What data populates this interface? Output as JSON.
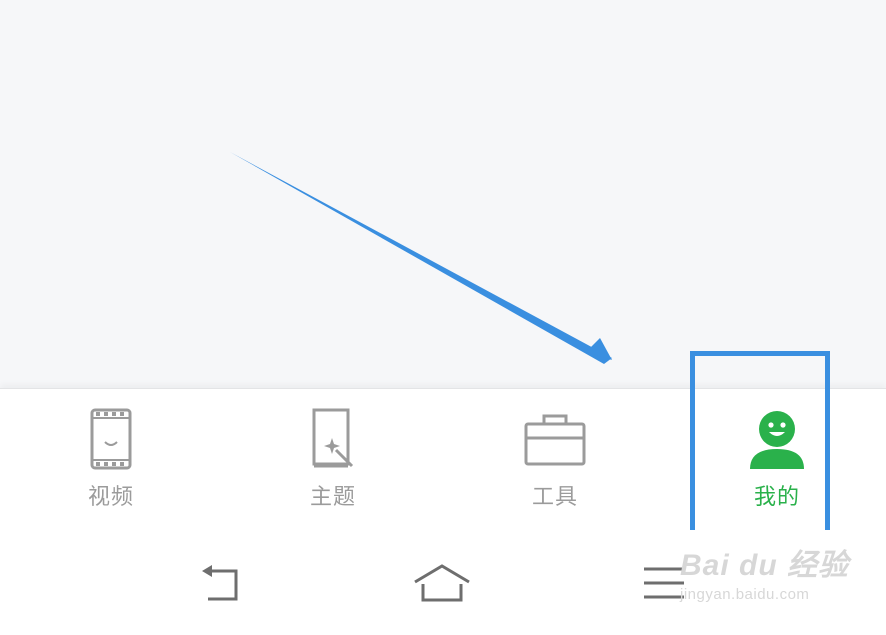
{
  "tabs": [
    {
      "label": "视频",
      "icon": "video-phone-icon",
      "active": false
    },
    {
      "label": "主题",
      "icon": "theme-book-icon",
      "active": false
    },
    {
      "label": "工具",
      "icon": "toolbox-icon",
      "active": false
    },
    {
      "label": "我的",
      "icon": "user-smile-icon",
      "active": true
    }
  ],
  "system_nav": [
    {
      "icon": "back-icon"
    },
    {
      "icon": "home-icon"
    },
    {
      "icon": "menu-icon"
    }
  ],
  "watermark": {
    "brand": "Bai du 经验",
    "url": "jingyan.baidu.com"
  },
  "colors": {
    "accent_green": "#2ab14b",
    "inactive_gray": "#9b9b9b",
    "annotation_blue": "#3a8fe0"
  }
}
